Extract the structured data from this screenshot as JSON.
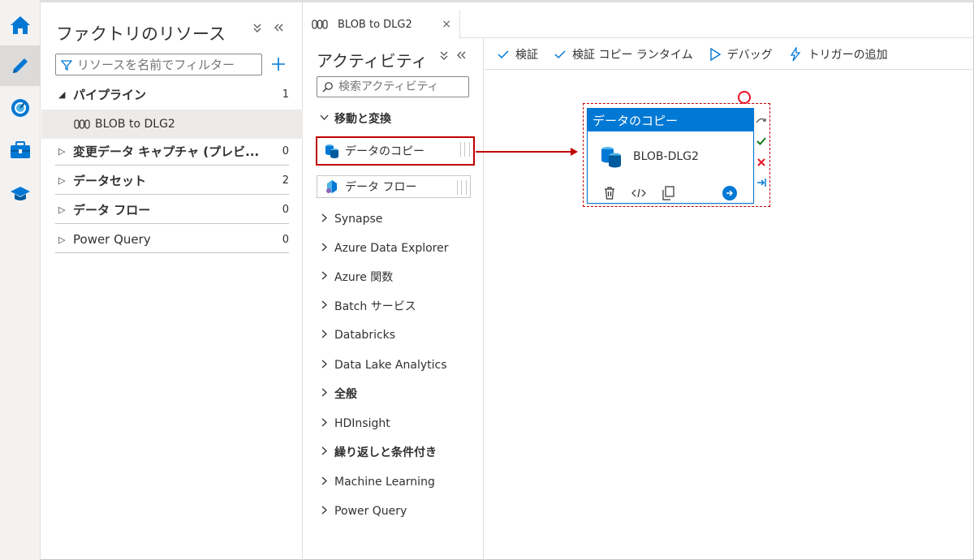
{
  "rail": {
    "items": [
      "home-icon",
      "pencil-icon",
      "monitor-icon",
      "toolbox-icon",
      "learn-icon"
    ]
  },
  "resources": {
    "title": "ファクトリのリソース",
    "filter_placeholder": "リソースを名前でフィルター",
    "tree": [
      {
        "label": "パイプライン",
        "count": "1",
        "expanded": true
      },
      {
        "label": "変更データ キャプチャ (プレビ...",
        "count": "0"
      },
      {
        "label": "データセット",
        "count": "2"
      },
      {
        "label": "データ フロー",
        "count": "0"
      },
      {
        "label": "Power Query",
        "count": "0"
      }
    ],
    "pipeline_item": "BLOB to DLG2"
  },
  "tab": {
    "label": "BLOB to DLG2",
    "close": "×"
  },
  "activities": {
    "title": "アクティビティ",
    "search_placeholder": "検索アクティビティ",
    "expanded_category": "移動と変換",
    "items": [
      "データのコピー",
      "データ フロー"
    ],
    "categories": [
      "Synapse",
      "Azure Data Explorer",
      "Azure 関数",
      "Batch サービス",
      "Databricks",
      "Data Lake Analytics",
      "全般",
      "HDInsight",
      "繰り返しと条件付き",
      "Machine Learning",
      "Power Query"
    ]
  },
  "toolbar": {
    "validate": "検証",
    "validate_copy_runtime": "検証 コピー ランタイム",
    "debug": "デバッグ",
    "add_trigger": "トリガーの追加"
  },
  "canvas": {
    "node_type": "データのコピー",
    "node_name": "BLOB-DLG2"
  },
  "colors": {
    "accent": "#0078d4",
    "highlight": "#c00000",
    "success": "#107c10",
    "error": "#e81123"
  }
}
